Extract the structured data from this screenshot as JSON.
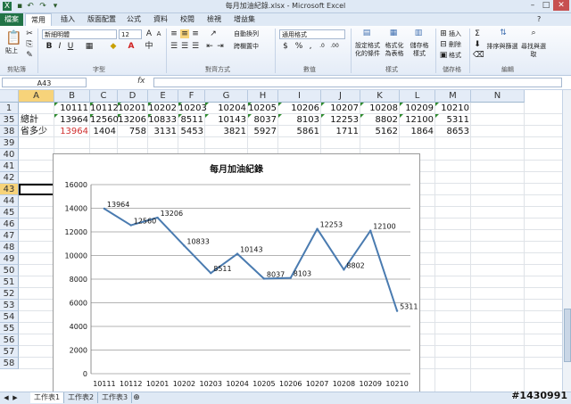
{
  "window": {
    "title": "每月加油紀錄.xlsx - Microsoft Excel",
    "quick_access": [
      "save-icon",
      "undo-icon",
      "redo-icon"
    ]
  },
  "tabs": [
    "檔案",
    "常用",
    "插入",
    "版面配置",
    "公式",
    "資料",
    "校閱",
    "檢視",
    "增益集"
  ],
  "ribbon": {
    "clipboard": {
      "paste_label": "貼上",
      "group_label": "剪貼簿"
    },
    "font": {
      "name": "新細明體",
      "size": "12",
      "group_label": "字型"
    },
    "alignment": {
      "wrap_label": "自動換列",
      "merge_label": "跨欄置中",
      "group_label": "對齊方式"
    },
    "number": {
      "format": "通用格式",
      "group_label": "數值"
    },
    "styles": {
      "cond_label": "設定格式化的條件",
      "table_label": "格式化為表格",
      "cell_label": "儲存格樣式",
      "group_label": "樣式"
    },
    "cells": {
      "insert_label": "插入",
      "delete_label": "刪除",
      "format_label": "格式",
      "group_label": "儲存格"
    },
    "editing": {
      "sort_label": "排序與篩選",
      "find_label": "尋找與選取",
      "group_label": "編輯"
    }
  },
  "formula_bar": {
    "name_box": "A43",
    "fx": "fx",
    "formula": ""
  },
  "columns": [
    "A",
    "B",
    "C",
    "D",
    "E",
    "F",
    "G",
    "H",
    "I",
    "J",
    "K",
    "L",
    "M",
    "N"
  ],
  "rows": [
    "1",
    "35",
    "38",
    "39",
    "40",
    "41",
    "42",
    "43",
    "44",
    "45",
    "46",
    "47",
    "48",
    "49",
    "50",
    "51",
    "52",
    "53",
    "54",
    "55",
    "56",
    "57",
    "58"
  ],
  "sheet": {
    "row1": [
      "",
      "10111",
      "10112",
      "10201",
      "10202",
      "10203",
      "10204",
      "10205",
      "10206",
      "10207",
      "10208",
      "10209",
      "10210",
      ""
    ],
    "row35": [
      "總計",
      "13964",
      "12560",
      "13206",
      "10833",
      "8511",
      "10143",
      "8037",
      "8103",
      "12253",
      "8802",
      "12100",
      "5311",
      ""
    ],
    "row38": [
      "省多少",
      "13964",
      "1404",
      "758",
      "3131",
      "5453",
      "3821",
      "5927",
      "5861",
      "1711",
      "5162",
      "1864",
      "8653",
      ""
    ]
  },
  "chart_data": {
    "type": "line",
    "title": "每月加油紀錄",
    "categories": [
      "10111",
      "10112",
      "10201",
      "10202",
      "10203",
      "10204",
      "10205",
      "10206",
      "10207",
      "10208",
      "10209",
      "10210"
    ],
    "series": [
      {
        "values": [
          13964,
          12560,
          13206,
          10833,
          8511,
          10143,
          8037,
          8103,
          12253,
          8802,
          12100,
          5311
        ]
      }
    ],
    "ylim": [
      0,
      16000
    ],
    "yticks": [
      0,
      2000,
      4000,
      6000,
      8000,
      10000,
      12000,
      14000,
      16000
    ],
    "grid": true,
    "legend": "none",
    "line_color": "#4a7bb0"
  },
  "sheet_tabs": [
    "工作表1",
    "工作表2",
    "工作表3"
  ],
  "watermark": "#1430991"
}
